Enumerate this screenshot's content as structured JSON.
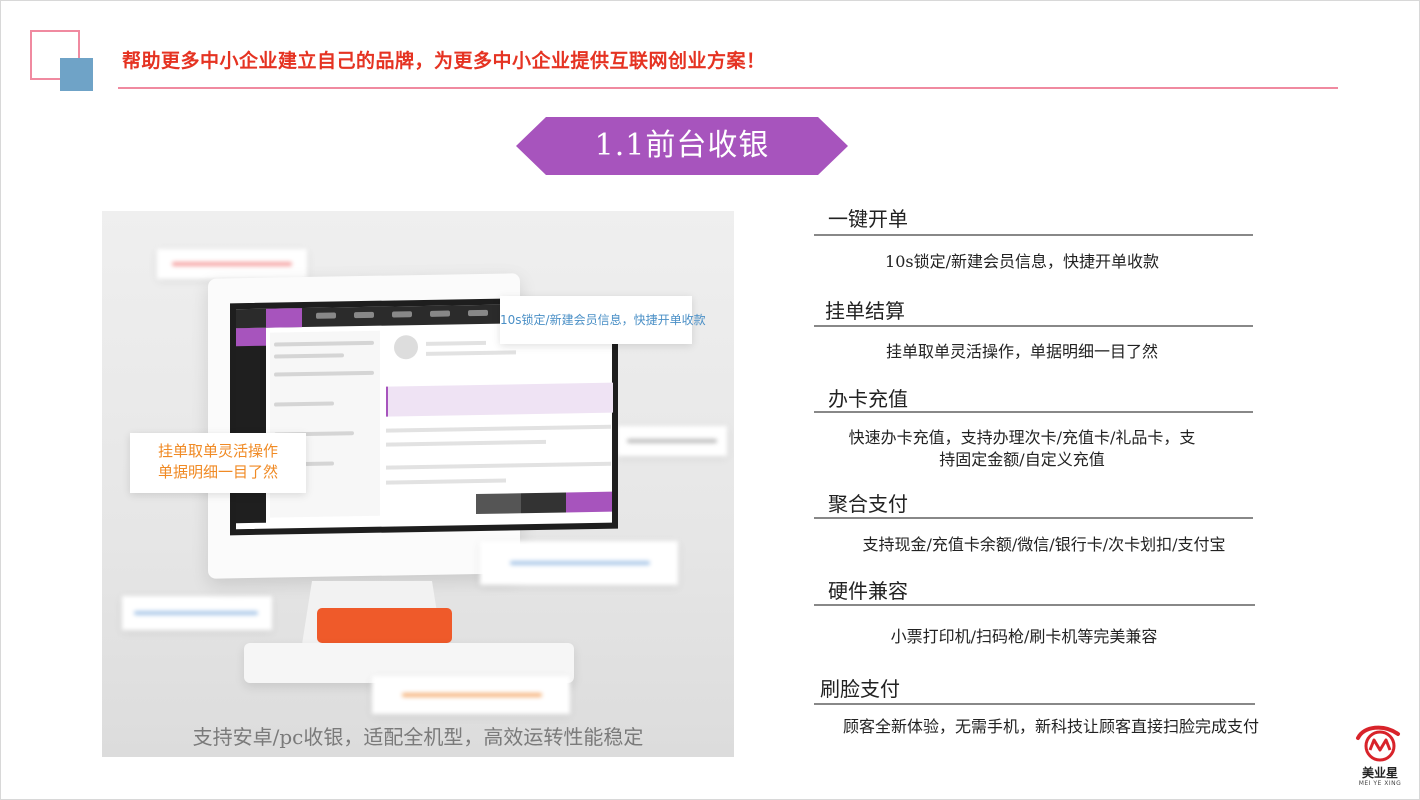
{
  "header": {
    "title": "帮助更多中小企业建立自己的品牌，为更多中小企业提供互联网创业方案！"
  },
  "section": {
    "title": "1.1前台收银"
  },
  "image": {
    "callout_blue": "10s锁定/新建会员信息，快捷开单收款",
    "callout_orange_line1": "挂单取单灵活操作",
    "callout_orange_line2": "单据明细一目了然",
    "caption": "支持安卓/pc收银，适配全机型，高效运转性能稳定"
  },
  "features": [
    {
      "title": "一键开单",
      "desc": [
        "10s锁定/新建会员信息，快捷开单收款"
      ]
    },
    {
      "title": "挂单结算",
      "desc": [
        "挂单取单灵活操作，单据明细一目了然"
      ]
    },
    {
      "title": "办卡充值",
      "desc": [
        "快速办卡充值，支持办理次卡/充值卡/礼品卡，支",
        "持固定金额/自定义充值"
      ]
    },
    {
      "title": "聚合支付",
      "desc": [
        "支持现金/充值卡余额/微信/银行卡/次卡划扣/支付宝"
      ]
    },
    {
      "title": "硬件兼容",
      "desc": [
        "小票打印机/扫码枪/刷卡机等完美兼容"
      ]
    },
    {
      "title": "刷脸支付",
      "desc": [
        "顾客全新体验，无需手机，新科技让顾客直接扫脸完成支付"
      ]
    }
  ],
  "logo": {
    "name": "美业星",
    "sub": "MEI YE XING"
  },
  "colors": {
    "header_red": "#e53322",
    "accent_pink": "#f08aa0",
    "accent_blue": "#6fa3c7",
    "banner_purple": "#a754bd",
    "callout_orange": "#f08a24",
    "callout_blue": "#4a8fc6",
    "logo_red": "#d8232a"
  }
}
